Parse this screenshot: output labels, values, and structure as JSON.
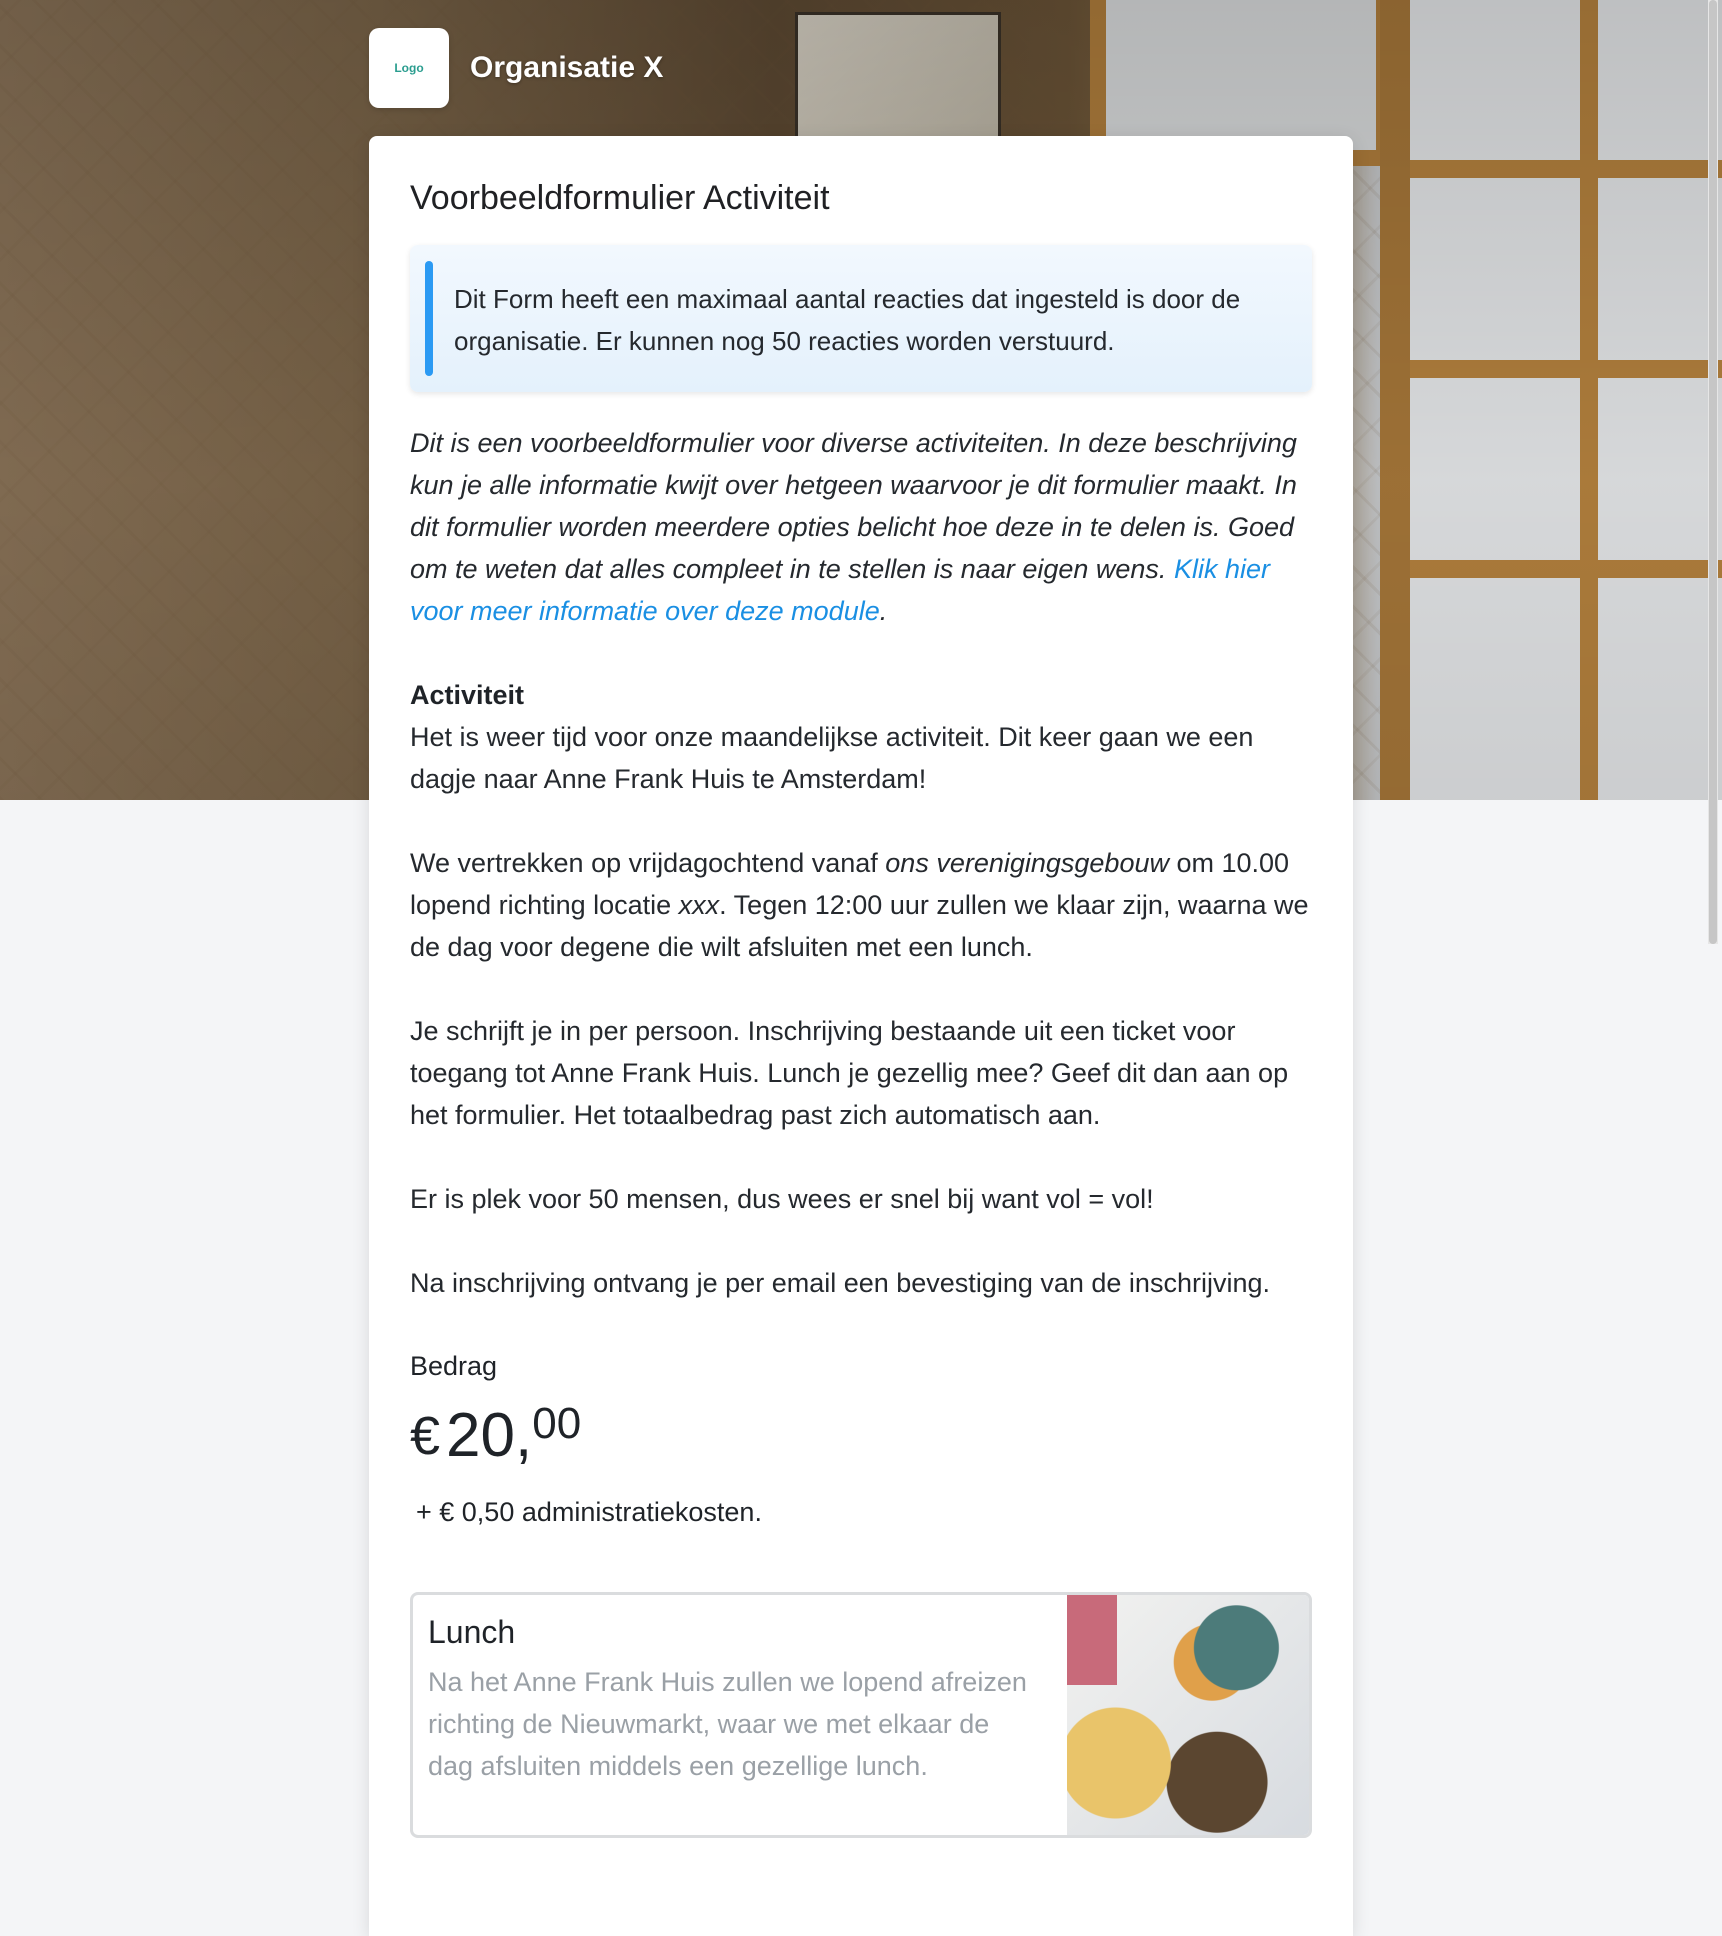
{
  "header": {
    "logo_text": "Logo",
    "org_name": "Organisatie X"
  },
  "form": {
    "title": "Voorbeeldformulier Activiteit",
    "notice": "Dit Form heeft een maximaal aantal reacties dat ingesteld is door de organisatie. Er kunnen nog 50 reacties worden verstuurd.",
    "intro_text": "Dit is een voorbeeldformulier voor diverse activiteiten. In deze beschrijving kun je alle informatie kwijt over hetgeen waarvoor je dit formulier maakt. In dit formulier worden meerdere opties belicht hoe deze in te delen is. Goed om te weten dat alles compleet in te stellen is naar eigen wens.",
    "intro_link": "Klik hier voor meer informatie over deze module",
    "intro_end": ".",
    "section_heading": "Activiteit",
    "para1": "Het is weer tijd voor onze maandelijkse activiteit. Dit keer gaan we een dagje naar Anne Frank Huis te Amsterdam!",
    "para2_a": "We vertrekken op vrijdagochtend vanaf ",
    "para2_b": "ons verenigingsgebouw",
    "para2_c": " om 10.00 lopend richting locatie ",
    "para2_d": "xxx",
    "para2_e": ". Tegen 12:00 uur zullen we klaar zijn, waarna we de dag voor degene die wilt afsluiten met een lunch.",
    "para3": "Je schrijft je in per persoon. Inschrijving bestaande uit een ticket voor toegang tot Anne Frank Huis. Lunch je gezellig mee? Geef dit dan aan op het formulier. Het totaalbedrag past zich automatisch aan.",
    "para4": "Er is plek voor 50 mensen, dus wees er snel bij want vol = vol!",
    "para5": "Na inschrijving ontvang je per email een bevestiging van de inschrijving."
  },
  "amount": {
    "label": "Bedrag",
    "currency": "€",
    "integer": "20,",
    "decimals": "00",
    "fee": "+ € 0,50 administratiekosten."
  },
  "option_lunch": {
    "title": "Lunch",
    "description": "Na het Anne Frank Huis zullen we lopend afreizen richting de Nieuwmarkt, waar we met elkaar de dag afsluiten middels een gezellige lunch."
  },
  "colors": {
    "accent": "#2b9af3",
    "link": "#1a8fe3"
  }
}
